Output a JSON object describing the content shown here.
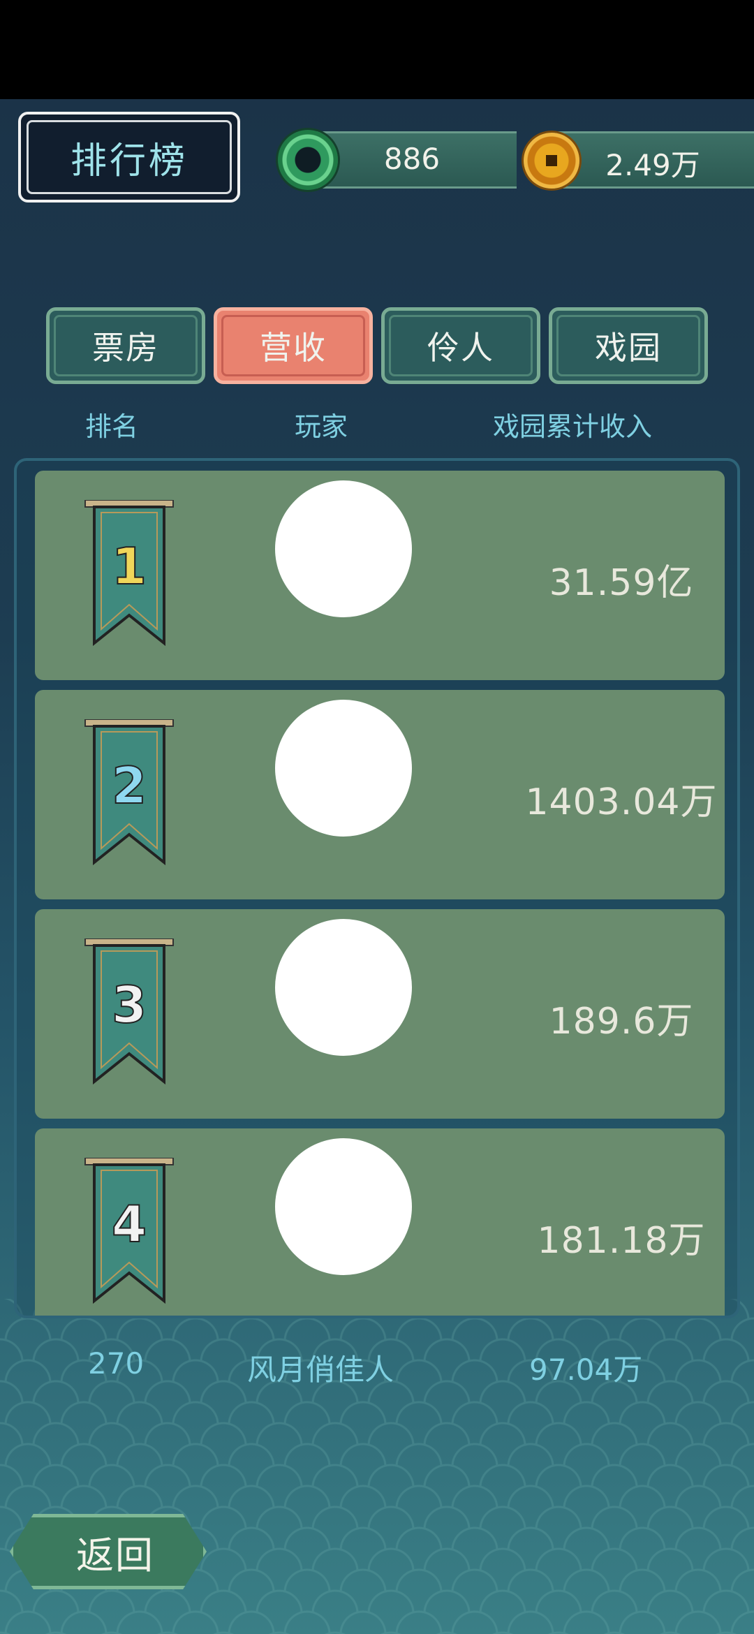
{
  "title": "排行榜",
  "currencies": {
    "jade": {
      "icon": "jade-icon",
      "value": "886"
    },
    "coin": {
      "icon": "coin-icon",
      "value": "2.49万"
    }
  },
  "tabs": [
    {
      "label": "票房",
      "active": false
    },
    {
      "label": "营收",
      "active": true
    },
    {
      "label": "伶人",
      "active": false
    },
    {
      "label": "戏园",
      "active": false
    }
  ],
  "columns": {
    "rank": "排名",
    "player": "玩家",
    "income": "戏园累计收入"
  },
  "rows": [
    {
      "rank": "1",
      "rank_color": "#f0d65a",
      "income": "31.59亿"
    },
    {
      "rank": "2",
      "rank_color": "#8fd8f0",
      "income": "1403.04万"
    },
    {
      "rank": "3",
      "rank_color": "#f2f2f2",
      "income": "189.6万"
    },
    {
      "rank": "4",
      "rank_color": "#f2f2f2",
      "income": "181.18万"
    }
  ],
  "my_entry": {
    "rank": "270",
    "player": "风月俏佳人",
    "income": "97.04万"
  },
  "back_label": "返回",
  "colors": {
    "active_tab": "#e9826f",
    "tab": "#2c5c5c",
    "row": "#6a8c6e",
    "accent_text": "#7fd0e2"
  }
}
